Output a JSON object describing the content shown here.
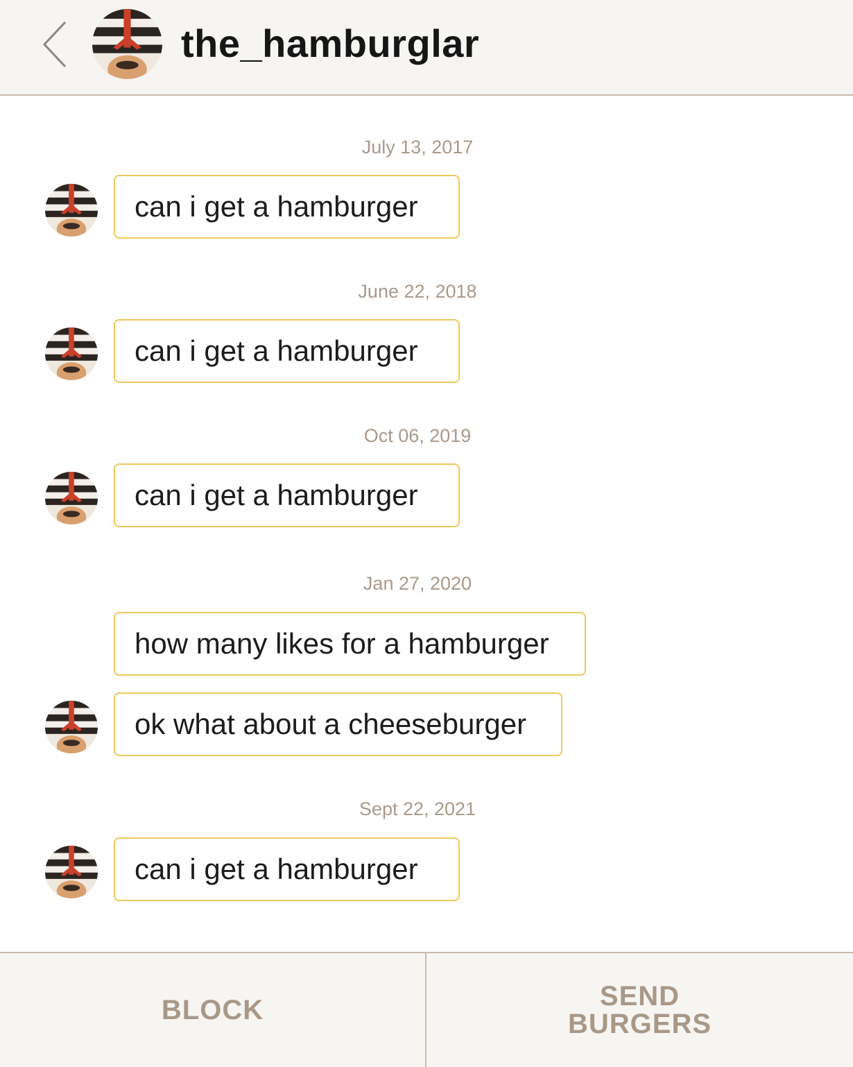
{
  "header": {
    "username": "the_hamburglar",
    "back_icon": "chevron-left-icon",
    "avatar_icon": "hamburglar-avatar"
  },
  "messages": [
    {
      "date": "July 13, 2017",
      "text": "can i get a hamburger",
      "sender": "them"
    },
    {
      "date": "June 22, 2018",
      "text": "can i get a hamburger",
      "sender": "them"
    },
    {
      "date": "Oct 06, 2019",
      "text": "can i get a hamburger",
      "sender": "them"
    },
    {
      "date": "Jan 27, 2020",
      "text": "how many likes for a hamburger",
      "sender": "me"
    },
    {
      "date": "",
      "text": "ok what about a cheeseburger",
      "sender": "them"
    },
    {
      "date": "Sept 22, 2021",
      "text": "can i get a hamburger",
      "sender": "them"
    }
  ],
  "footer": {
    "block_label": "BLOCK",
    "send_label_line1": "SEND",
    "send_label_line2": "BURGERS"
  },
  "colors": {
    "bubble_border": "#efc75a",
    "muted_text": "#a8998a",
    "button_text": "#a89888",
    "divider": "#c8bba9",
    "bar_background": "#f7f5f2"
  }
}
